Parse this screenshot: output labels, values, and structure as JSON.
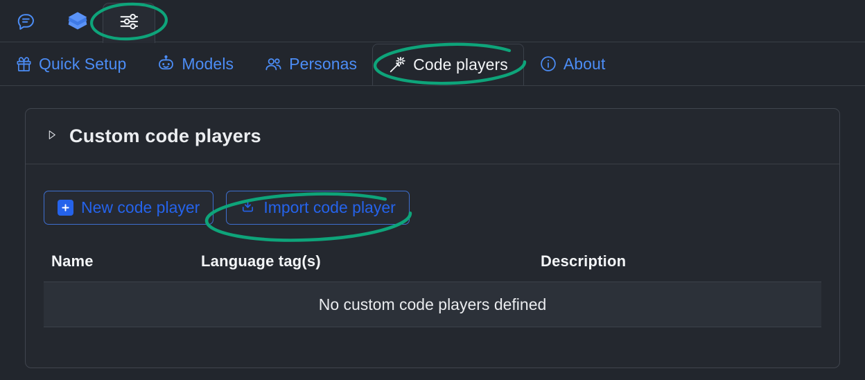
{
  "window": {
    "background": "#22262d",
    "accent_blue": "#2563eb",
    "tab_blue": "#4c8df6",
    "annotation_color": "#0ea47a"
  },
  "icon_bar": {
    "items": [
      {
        "icon": "chat-bubble-icon",
        "name": "chat",
        "active": false
      },
      {
        "icon": "layers-icon",
        "name": "layers",
        "active": false
      },
      {
        "icon": "sliders-icon",
        "name": "settings",
        "active": true
      }
    ]
  },
  "tabs": [
    {
      "label": "Quick Setup",
      "icon": "gift-icon",
      "active": false
    },
    {
      "label": "Models",
      "icon": "robot-icon",
      "active": false
    },
    {
      "label": "Personas",
      "icon": "users-icon",
      "active": false
    },
    {
      "label": "Code players",
      "icon": "magic-wand-icon",
      "active": true
    },
    {
      "label": "About",
      "icon": "info-circle-icon",
      "active": false
    }
  ],
  "panel": {
    "title": "Custom code players",
    "expander_icon": "triangle-right-icon",
    "expanded": true
  },
  "buttons": {
    "new_code_player": {
      "label": "New code player",
      "icon": "plus-icon"
    },
    "import_code_player": {
      "label": "Import code player",
      "icon": "import-download-icon"
    }
  },
  "table": {
    "columns": [
      "Name",
      "Language tag(s)",
      "Description"
    ],
    "rows": [],
    "empty_message": "No custom code players defined"
  },
  "annotations": [
    {
      "target": "settings-icon-tab",
      "shape": "ellipse"
    },
    {
      "target": "tab-code-players",
      "shape": "ellipse"
    },
    {
      "target": "import-code-player-button",
      "shape": "ellipse"
    }
  ]
}
